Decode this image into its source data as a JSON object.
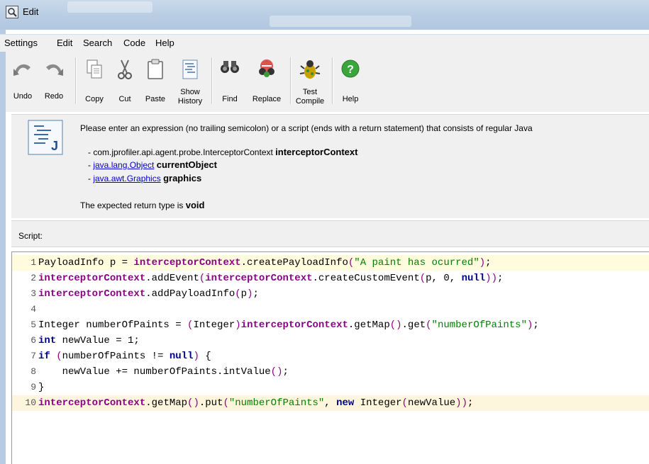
{
  "window": {
    "title": "Edit"
  },
  "menu": [
    "Settings",
    "Edit",
    "Search",
    "Code",
    "Help"
  ],
  "toolbar": {
    "undo": "Undo",
    "redo": "Redo",
    "copy": "Copy",
    "cut": "Cut",
    "paste": "Paste",
    "show_history_1": "Show",
    "show_history_2": "History",
    "find": "Find",
    "replace": "Replace",
    "test_compile_1": "Test",
    "test_compile_2": "Compile",
    "help": "Help"
  },
  "description": {
    "intro": "Please enter an expression (no trailing semicolon) or a script (ends with a return statement) that consists of regular Java",
    "params": [
      {
        "prefix": "- ",
        "type": "com.jprofiler.api.agent.probe.InterceptorContext",
        "name": "interceptorContext",
        "link": false
      },
      {
        "prefix": "- ",
        "type": "java.lang.Object",
        "name": "currentObject",
        "link": true
      },
      {
        "prefix": "- ",
        "type": "java.awt.Graphics",
        "name": "graphics",
        "link": true
      }
    ],
    "return_prefix": "The expected return type is ",
    "return_type": "void"
  },
  "script_label": "Script:",
  "code": [
    {
      "n": "1",
      "text": "PayloadInfo p = interceptorContext.createPayloadInfo(\"A paint has ocurred\");"
    },
    {
      "n": "2",
      "text": "interceptorContext.addEvent(interceptorContext.createCustomEvent(p, 0, null));"
    },
    {
      "n": "3",
      "text": "interceptorContext.addPayloadInfo(p);"
    },
    {
      "n": "4",
      "text": ""
    },
    {
      "n": "5",
      "text": "Integer numberOfPaints = (Integer)interceptorContext.getMap().get(\"numberOfPaints\");"
    },
    {
      "n": "6",
      "text": "int newValue = 1;"
    },
    {
      "n": "7",
      "text": "if (numberOfPaints != null) {"
    },
    {
      "n": "8",
      "text": "    newValue += numberOfPaints.intValue();"
    },
    {
      "n": "9",
      "text": "}"
    },
    {
      "n": "10",
      "text": "interceptorContext.getMap().put(\"numberOfPaints\", new Integer(newValue));"
    }
  ]
}
